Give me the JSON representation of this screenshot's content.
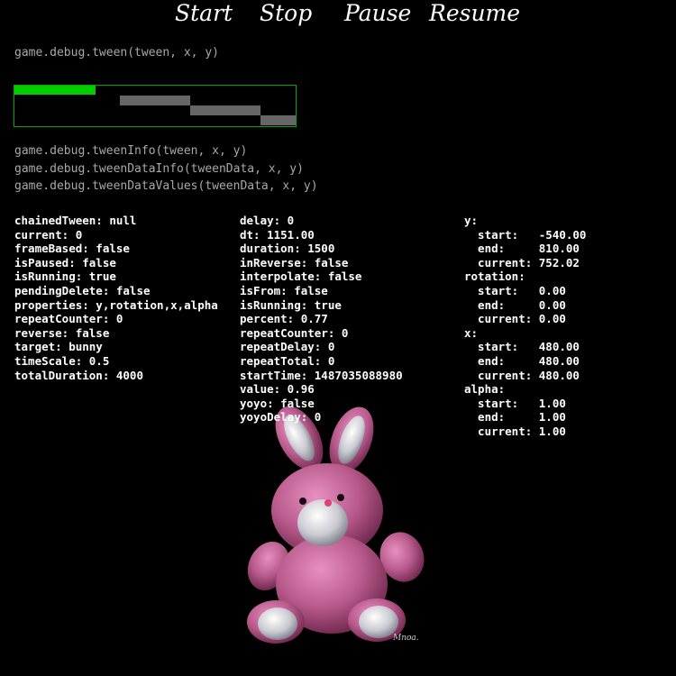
{
  "menu": {
    "start": "Start",
    "stop": "Stop",
    "pause": "Pause",
    "resume": "Resume"
  },
  "code_lines": {
    "tween": "game.debug.tween(tween, x, y)",
    "tween_info": "game.debug.tweenInfo(tween, x, y)",
    "tween_data_info": "game.debug.tweenDataInfo(tweenData, x, y)",
    "tween_data_values": "game.debug.tweenDataValues(tweenData, x, y)"
  },
  "tween_bar": {
    "progress": 0.29,
    "active_color": "#00cc00",
    "inactive_color": "#666666",
    "border_color": "#00aa00"
  },
  "tween_info": [
    "chainedTween: null",
    "current: 0",
    "frameBased: false",
    "isPaused: false",
    "isRunning: true",
    "pendingDelete: false",
    "properties: y,rotation,x,alpha",
    "repeatCounter: 0",
    "reverse: false",
    "target: bunny",
    "timeScale: 0.5",
    "totalDuration: 4000"
  ],
  "tween_data_info": [
    "delay: 0",
    "dt: 1151.00",
    "duration: 1500",
    "inReverse: false",
    "interpolate: false",
    "isFrom: false",
    "isRunning: true",
    "percent: 0.77",
    "repeatCounter: 0",
    "repeatDelay: 0",
    "repeatTotal: 0",
    "startTime: 1487035088980",
    "value: 0.96",
    "yoyo: false",
    "yoyoDelay: 0"
  ],
  "tween_data_values": [
    "y:",
    "  start:   -540.00",
    "  end:     810.00",
    "  current: 752.02",
    "rotation:",
    "  start:   0.00",
    "  end:     0.00",
    "  current: 0.00",
    "x:",
    "  start:   480.00",
    "  end:     480.00",
    "  current: 480.00",
    "alpha:",
    "  start:   1.00",
    "  end:     1.00",
    "  current: 1.00"
  ],
  "sprite": {
    "signature": "Mnoa.",
    "body_color": "#b85a8c"
  }
}
